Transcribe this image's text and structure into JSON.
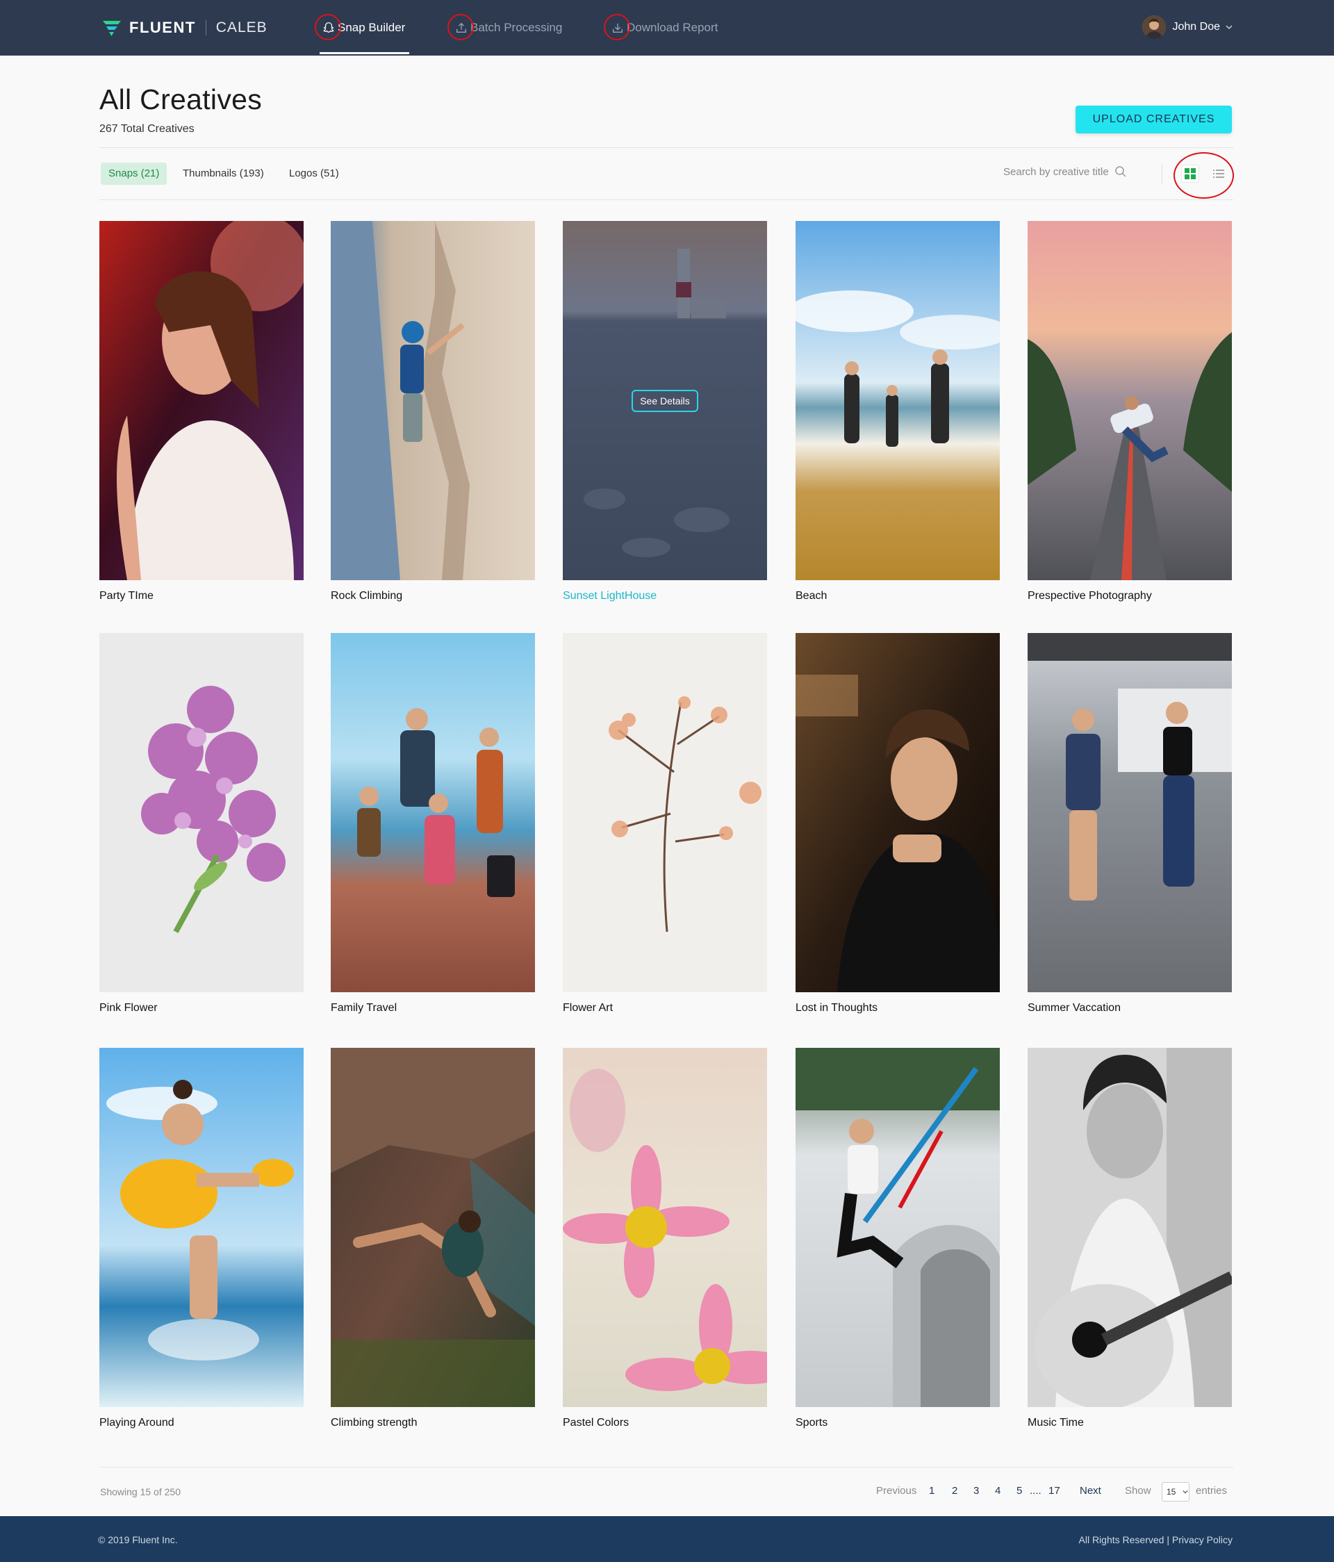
{
  "app": {
    "brand": "FLUENT",
    "client": "CALEB",
    "nav": {
      "snap_builder": "Snap Builder",
      "batch_processing": "Batch Processing",
      "download_report": "Download Report"
    },
    "user_name": "John Doe"
  },
  "header": {
    "title": "All Creatives",
    "total": "267 Total Creatives",
    "upload_label": "UPLOAD CREATIVES"
  },
  "filters": {
    "tabs": [
      "Snaps (21)",
      "Thumbnails (193)",
      "Logos (51)"
    ],
    "active_tab": "Snaps (21)",
    "search_placeholder": "Search by creative title"
  },
  "creatives": [
    {
      "title": "Party TIme",
      "icon": "party-photo"
    },
    {
      "title": "Rock Climbing",
      "icon": "climbing-photo"
    },
    {
      "title": "Sunset LightHouse",
      "icon": "lighthouse-photo",
      "hovered": true,
      "action": "See Details"
    },
    {
      "title": "Beach",
      "icon": "beach-photo"
    },
    {
      "title": "Prespective Photography",
      "icon": "road-jump-photo"
    },
    {
      "title": "Pink Flower",
      "icon": "lilac-photo"
    },
    {
      "title": "Family Travel",
      "icon": "family-photo"
    },
    {
      "title": "Flower Art",
      "icon": "dried-flower-photo"
    },
    {
      "title": "Lost in Thoughts",
      "icon": "portrait-photo"
    },
    {
      "title": "Summer Vaccation",
      "icon": "friends-photo"
    },
    {
      "title": "Playing  Around",
      "icon": "girl-beach-photo"
    },
    {
      "title": "Climbing strength",
      "icon": "boulder-photo"
    },
    {
      "title": "Pastel Colors",
      "icon": "daisy-photo"
    },
    {
      "title": "Sports",
      "icon": "scooter-photo"
    },
    {
      "title": "Music Time",
      "icon": "guitar-photo"
    }
  ],
  "pagination": {
    "showing": "Showing 15 of 250",
    "previous": "Previous",
    "pages": [
      "1",
      "2",
      "3",
      "4",
      "5",
      "....",
      "17"
    ],
    "next": "Next",
    "show_label": "Show",
    "entries_value": "15",
    "entries_label": "entries"
  },
  "footer": {
    "copyright": "© 2019 Fluent Inc.",
    "rights": "All Rights Reserved",
    "privacy": "Privacy Policy"
  },
  "colors": {
    "nav_bg": "#2e3a50",
    "accent": "#23e3ef",
    "active_tab_bg": "#d6efe0",
    "active_tab_text": "#1e8a48",
    "footer_bg": "#1d3b5f",
    "annotation_red": "#d9141b"
  }
}
